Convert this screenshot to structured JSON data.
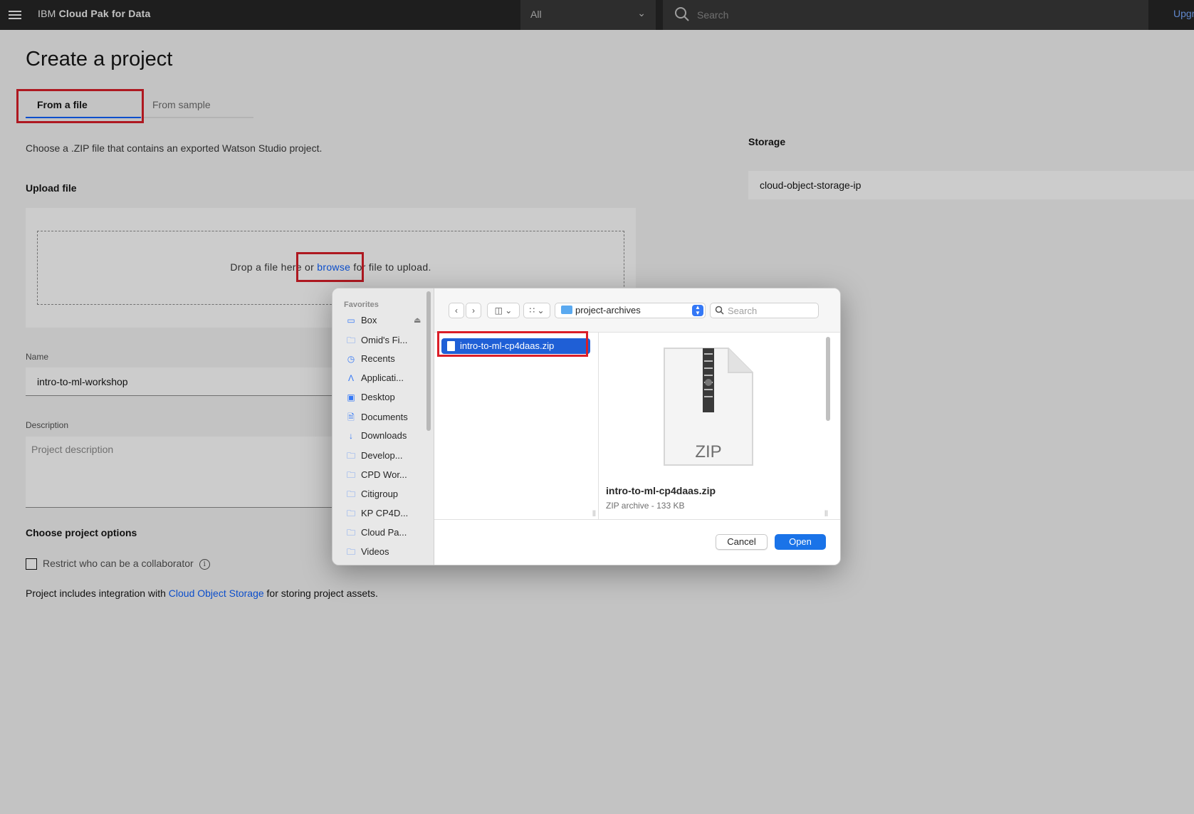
{
  "header": {
    "brand_prefix": "IBM",
    "brand_name": "Cloud Pak for Data",
    "scope_value": "All",
    "search_placeholder": "Search",
    "upgrade_label": "Upgr"
  },
  "main": {
    "title": "Create a project",
    "tabs": [
      {
        "label": "From a file",
        "active": true
      },
      {
        "label": "From sample",
        "active": false
      }
    ],
    "description": "Choose a .ZIP file that contains an exported Watson Studio project.",
    "upload_label": "Upload file",
    "dropzone": {
      "prefix": "Drop a file here or ",
      "link": "browse",
      "suffix": " for file to upload."
    },
    "name_label": "Name",
    "name_value": "intro-to-ml-workshop",
    "description_label": "Description",
    "description_placeholder": "Project description",
    "options_label": "Choose project options",
    "restrict_label": "Restrict who can be a collaborator",
    "integration": {
      "prefix": "Project includes integration with ",
      "link": "Cloud Object Storage",
      "suffix": " for storing project assets."
    },
    "storage_label": "Storage",
    "storage_value": "cloud-object-storage-ip"
  },
  "finder": {
    "favorites_heading": "Favorites",
    "sidebar_items": [
      {
        "label": "Box",
        "icon": "drive-icon"
      },
      {
        "label": "Omid's Fi...",
        "icon": "folder-icon"
      },
      {
        "label": "Recents",
        "icon": "clock-icon"
      },
      {
        "label": "Applicati...",
        "icon": "applications-icon"
      },
      {
        "label": "Desktop",
        "icon": "desktop-icon"
      },
      {
        "label": "Documents",
        "icon": "document-icon"
      },
      {
        "label": "Downloads",
        "icon": "download-icon"
      },
      {
        "label": "Develop...",
        "icon": "folder-icon"
      },
      {
        "label": "CPD Wor...",
        "icon": "folder-icon"
      },
      {
        "label": "Citigroup",
        "icon": "folder-icon"
      },
      {
        "label": "KP CP4D...",
        "icon": "folder-icon"
      },
      {
        "label": "Cloud Pa...",
        "icon": "folder-icon"
      },
      {
        "label": "Videos",
        "icon": "folder-icon"
      }
    ],
    "current_folder": "project-archives",
    "search_placeholder": "Search",
    "selected_file": "intro-to-ml-cp4daas.zip",
    "preview_badge": "ZIP",
    "preview_name": "intro-to-ml-cp4daas.zip",
    "preview_meta": "ZIP archive - 133 KB",
    "cancel_label": "Cancel",
    "open_label": "Open"
  },
  "colors": {
    "ibm_blue": "#0f62fe",
    "highlight_red": "#da1e28",
    "mac_selection": "#1f5fd6",
    "mac_accent": "#1a73e8"
  }
}
